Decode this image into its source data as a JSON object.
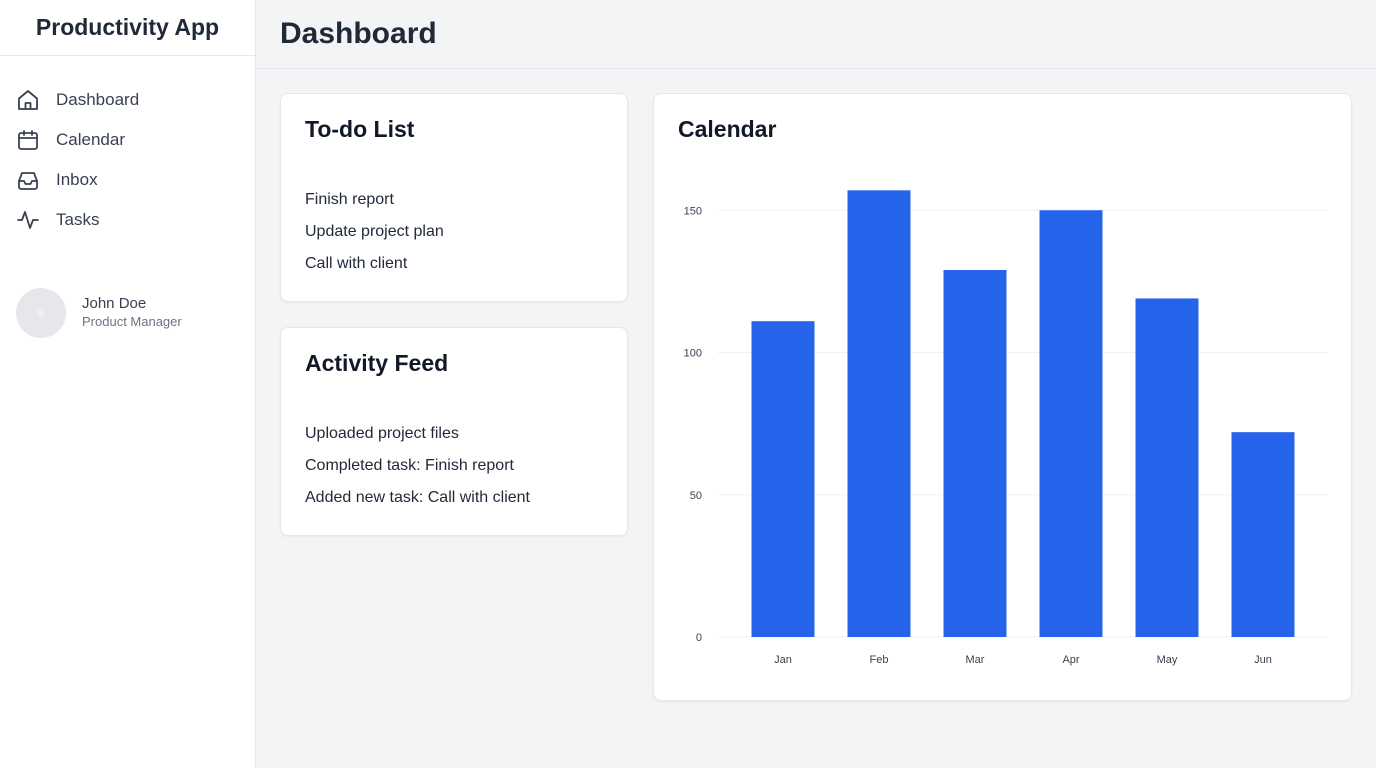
{
  "app": {
    "title": "Productivity App"
  },
  "sidebar": {
    "items": [
      {
        "label": "Dashboard",
        "icon": "home-icon"
      },
      {
        "label": "Calendar",
        "icon": "calendar-icon"
      },
      {
        "label": "Inbox",
        "icon": "inbox-icon"
      },
      {
        "label": "Tasks",
        "icon": "activity-icon"
      }
    ]
  },
  "user": {
    "name": "John Doe",
    "role": "Product Manager"
  },
  "header": {
    "title": "Dashboard"
  },
  "todo": {
    "title": "To-do List",
    "items": [
      "Finish report",
      "Update project plan",
      "Call with client"
    ]
  },
  "activity": {
    "title": "Activity Feed",
    "items": [
      "Uploaded project files",
      "Completed task: Finish report",
      "Added new task: Call with client"
    ]
  },
  "calendar": {
    "title": "Calendar"
  },
  "colors": {
    "bar": "#2563eb",
    "grid": "#f0f0f0",
    "background": "#f3f4f6"
  },
  "chart_data": {
    "type": "bar",
    "categories": [
      "Jan",
      "Feb",
      "Mar",
      "Apr",
      "May",
      "Jun"
    ],
    "values": [
      111,
      157,
      129,
      150,
      119,
      72
    ],
    "yticks": [
      0,
      50,
      100,
      150
    ],
    "ylim": [
      0,
      160
    ],
    "grid": true,
    "title": "",
    "xlabel": "",
    "ylabel": ""
  }
}
